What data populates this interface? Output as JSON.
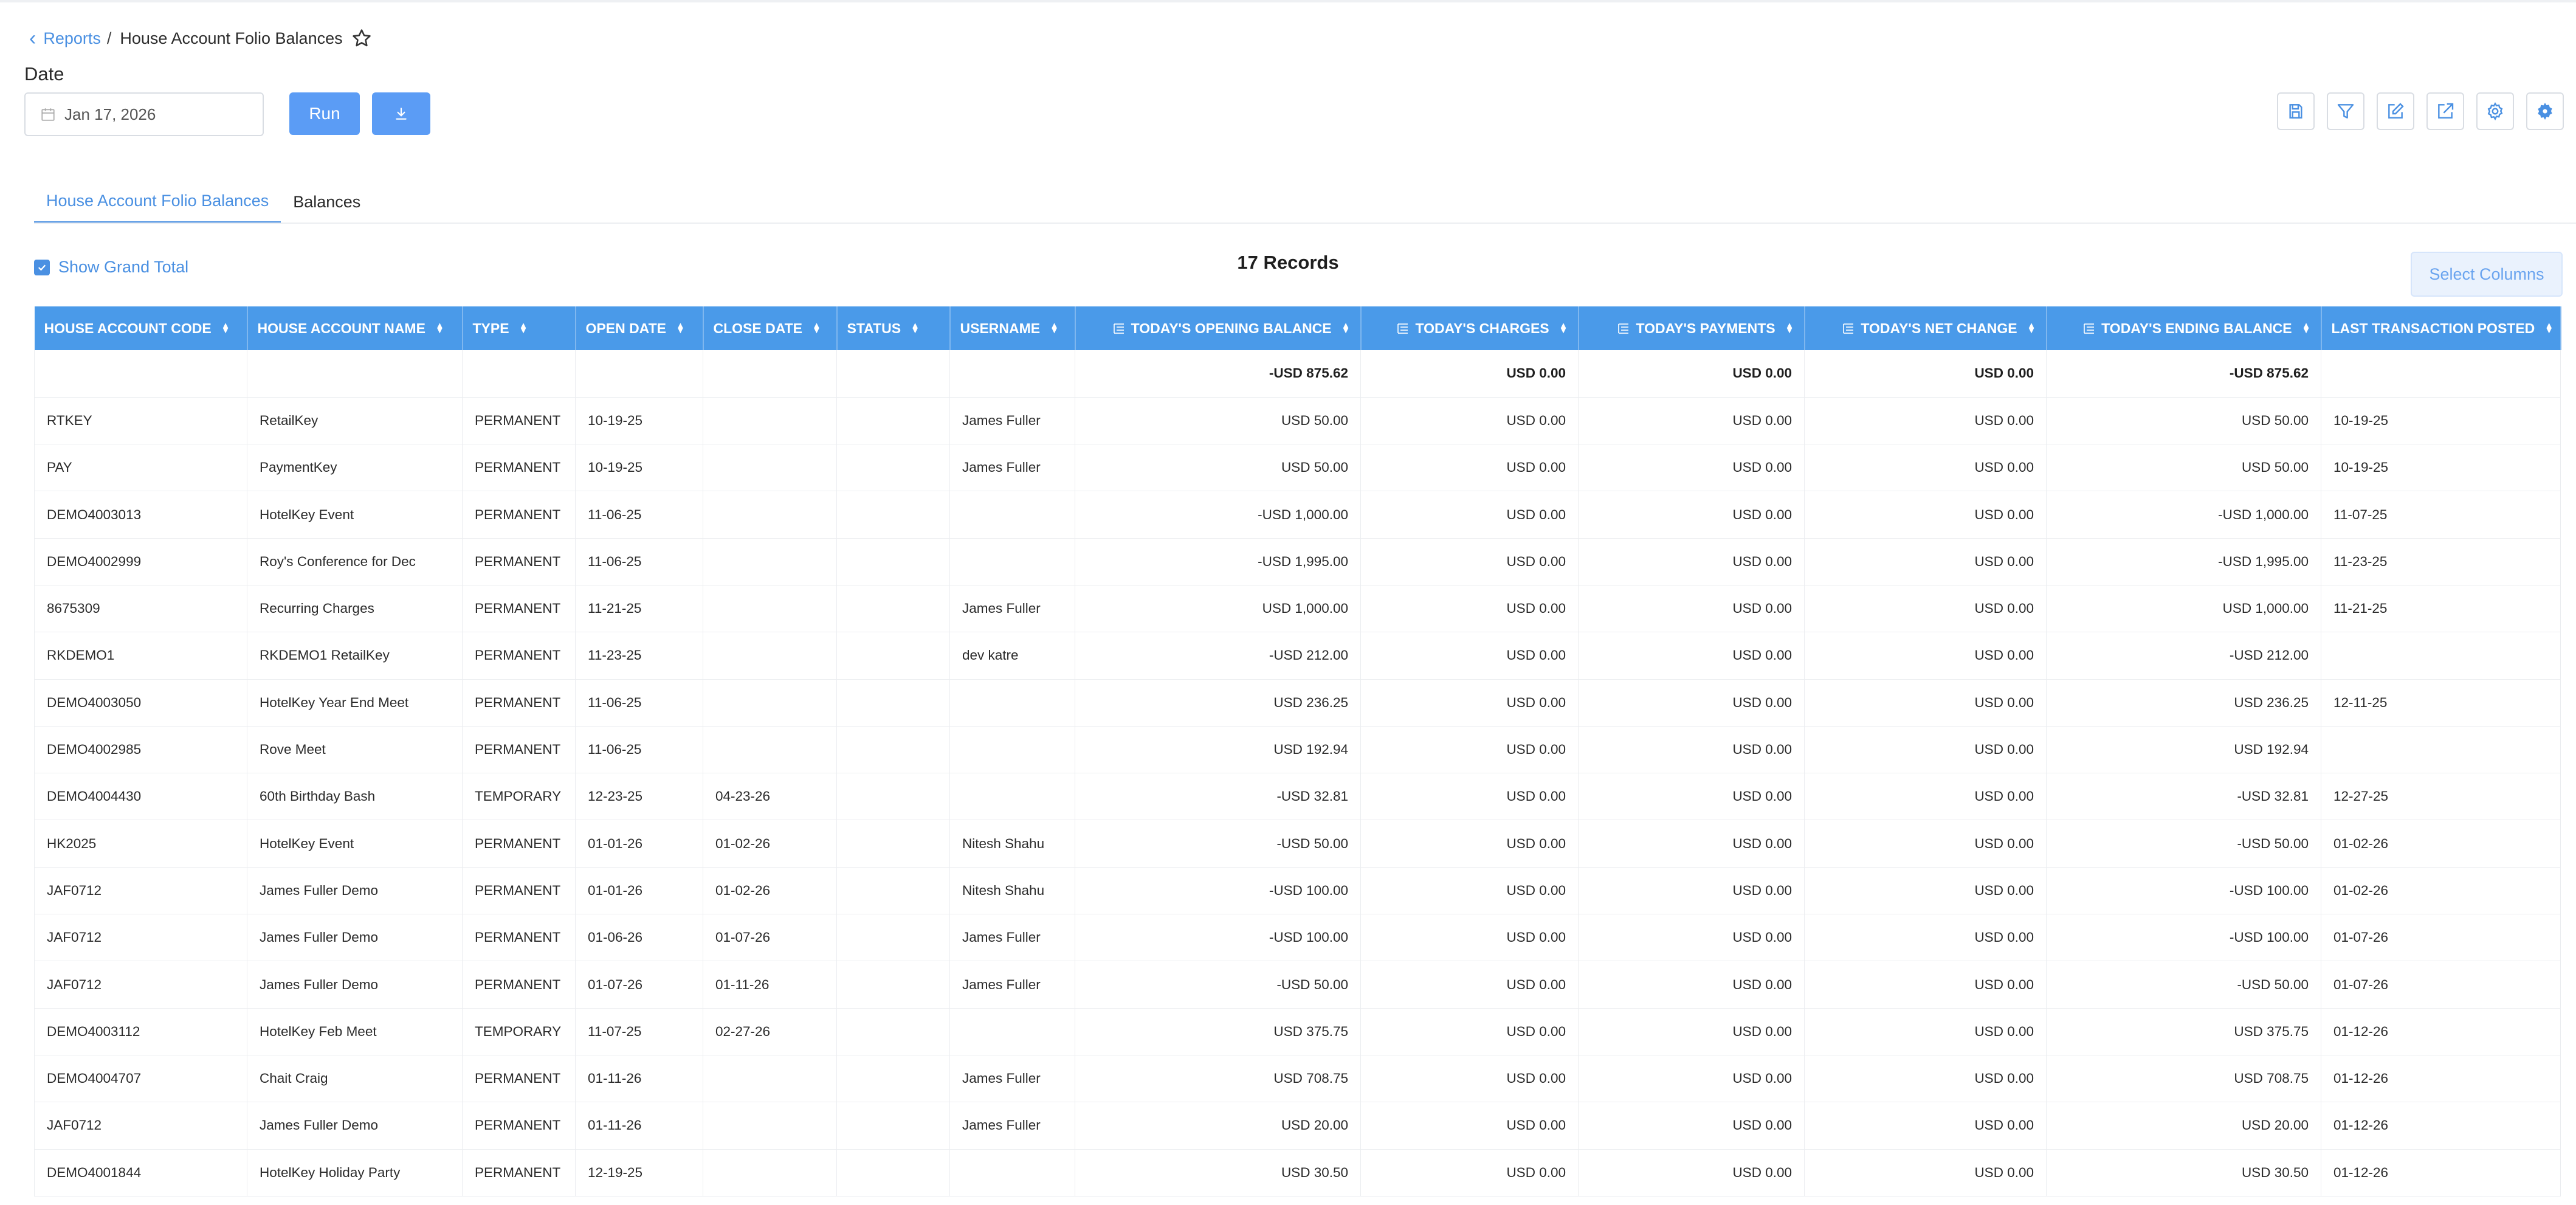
{
  "breadcrumb": {
    "parent": "Reports",
    "separator": "/",
    "current": "House Account Folio Balances"
  },
  "date_label": "Date",
  "date_value": "Jan 17, 2026",
  "run_label": "Run",
  "tabs": [
    {
      "label": "House Account Folio Balances",
      "active": true
    },
    {
      "label": "Balances",
      "active": false
    }
  ],
  "show_grand_total_label": "Show Grand Total",
  "records_label": "17 Records",
  "select_columns_label": "Select Columns",
  "columns": [
    "HOUSE ACCOUNT CODE",
    "HOUSE ACCOUNT NAME",
    "TYPE",
    "OPEN DATE",
    "CLOSE DATE",
    "STATUS",
    "USERNAME",
    "TODAY'S OPENING BALANCE",
    "TODAY'S CHARGES",
    "TODAY'S PAYMENTS",
    "TODAY'S NET CHANGE",
    "TODAY'S ENDING BALANCE",
    "LAST TRANSACTION POSTED"
  ],
  "totals": [
    "",
    "",
    "",
    "",
    "",
    "",
    "",
    "-USD 875.62",
    "USD 0.00",
    "USD 0.00",
    "USD 0.00",
    "-USD 875.62",
    ""
  ],
  "rows": [
    [
      "RTKEY",
      "RetailKey",
      "PERMANENT",
      "10-19-25",
      "",
      "",
      "James Fuller",
      "USD 50.00",
      "USD 0.00",
      "USD 0.00",
      "USD 0.00",
      "USD 50.00",
      "10-19-25"
    ],
    [
      "PAY",
      "PaymentKey",
      "PERMANENT",
      "10-19-25",
      "",
      "",
      "James Fuller",
      "USD 50.00",
      "USD 0.00",
      "USD 0.00",
      "USD 0.00",
      "USD 50.00",
      "10-19-25"
    ],
    [
      "DEMO4003013",
      "HotelKey Event",
      "PERMANENT",
      "11-06-25",
      "",
      "",
      "",
      "-USD 1,000.00",
      "USD 0.00",
      "USD 0.00",
      "USD 0.00",
      "-USD 1,000.00",
      "11-07-25"
    ],
    [
      "DEMO4002999",
      "Roy's Conference for Dec",
      "PERMANENT",
      "11-06-25",
      "",
      "",
      "",
      "-USD 1,995.00",
      "USD 0.00",
      "USD 0.00",
      "USD 0.00",
      "-USD 1,995.00",
      "11-23-25"
    ],
    [
      "8675309",
      "Recurring Charges",
      "PERMANENT",
      "11-21-25",
      "",
      "",
      "James Fuller",
      "USD 1,000.00",
      "USD 0.00",
      "USD 0.00",
      "USD 0.00",
      "USD 1,000.00",
      "11-21-25"
    ],
    [
      "RKDEMO1",
      "RKDEMO1 RetailKey",
      "PERMANENT",
      "11-23-25",
      "",
      "",
      "dev katre",
      "-USD 212.00",
      "USD 0.00",
      "USD 0.00",
      "USD 0.00",
      "-USD 212.00",
      ""
    ],
    [
      "DEMO4003050",
      "HotelKey Year End Meet",
      "PERMANENT",
      "11-06-25",
      "",
      "",
      "",
      "USD 236.25",
      "USD 0.00",
      "USD 0.00",
      "USD 0.00",
      "USD 236.25",
      "12-11-25"
    ],
    [
      "DEMO4002985",
      "Rove Meet",
      "PERMANENT",
      "11-06-25",
      "",
      "",
      "",
      "USD 192.94",
      "USD 0.00",
      "USD 0.00",
      "USD 0.00",
      "USD 192.94",
      ""
    ],
    [
      "DEMO4004430",
      "60th Birthday Bash",
      "TEMPORARY",
      "12-23-25",
      "04-23-26",
      "",
      "",
      "-USD 32.81",
      "USD 0.00",
      "USD 0.00",
      "USD 0.00",
      "-USD 32.81",
      "12-27-25"
    ],
    [
      "HK2025",
      "HotelKey Event",
      "PERMANENT",
      "01-01-26",
      "01-02-26",
      "",
      "Nitesh Shahu",
      "-USD 50.00",
      "USD 0.00",
      "USD 0.00",
      "USD 0.00",
      "-USD 50.00",
      "01-02-26"
    ],
    [
      "JAF0712",
      "James Fuller Demo",
      "PERMANENT",
      "01-01-26",
      "01-02-26",
      "",
      "Nitesh Shahu",
      "-USD 100.00",
      "USD 0.00",
      "USD 0.00",
      "USD 0.00",
      "-USD 100.00",
      "01-02-26"
    ],
    [
      "JAF0712",
      "James Fuller Demo",
      "PERMANENT",
      "01-06-26",
      "01-07-26",
      "",
      "James Fuller",
      "-USD 100.00",
      "USD 0.00",
      "USD 0.00",
      "USD 0.00",
      "-USD 100.00",
      "01-07-26"
    ],
    [
      "JAF0712",
      "James Fuller Demo",
      "PERMANENT",
      "01-07-26",
      "01-11-26",
      "",
      "James Fuller",
      "-USD 50.00",
      "USD 0.00",
      "USD 0.00",
      "USD 0.00",
      "-USD 50.00",
      "01-07-26"
    ],
    [
      "DEMO4003112",
      "HotelKey Feb Meet",
      "TEMPORARY",
      "11-07-25",
      "02-27-26",
      "",
      "",
      "USD 375.75",
      "USD 0.00",
      "USD 0.00",
      "USD 0.00",
      "USD 375.75",
      "01-12-26"
    ],
    [
      "DEMO4004707",
      "Chait Craig",
      "PERMANENT",
      "01-11-26",
      "",
      "",
      "James Fuller",
      "USD 708.75",
      "USD 0.00",
      "USD 0.00",
      "USD 0.00",
      "USD 708.75",
      "01-12-26"
    ],
    [
      "JAF0712",
      "James Fuller Demo",
      "PERMANENT",
      "01-11-26",
      "",
      "",
      "James Fuller",
      "USD 20.00",
      "USD 0.00",
      "USD 0.00",
      "USD 0.00",
      "USD 20.00",
      "01-12-26"
    ],
    [
      "DEMO4001844",
      "HotelKey Holiday Party",
      "PERMANENT",
      "12-19-25",
      "",
      "",
      "",
      "USD 30.50",
      "USD 0.00",
      "USD 0.00",
      "USD 0.00",
      "USD 30.50",
      "01-12-26"
    ]
  ],
  "icons": {
    "back": "chevron-left-icon",
    "star": "star-icon",
    "calendar": "calendar-icon",
    "download": "download-icon",
    "toolbar": [
      "save-icon",
      "filter-icon",
      "edit-icon",
      "external-link-icon",
      "settings-icon",
      "advanced-settings-icon"
    ]
  },
  "colors": {
    "accent": "#4a90e2",
    "header_bg": "#4a9ae9",
    "button_bg": "#5b9cf5"
  }
}
